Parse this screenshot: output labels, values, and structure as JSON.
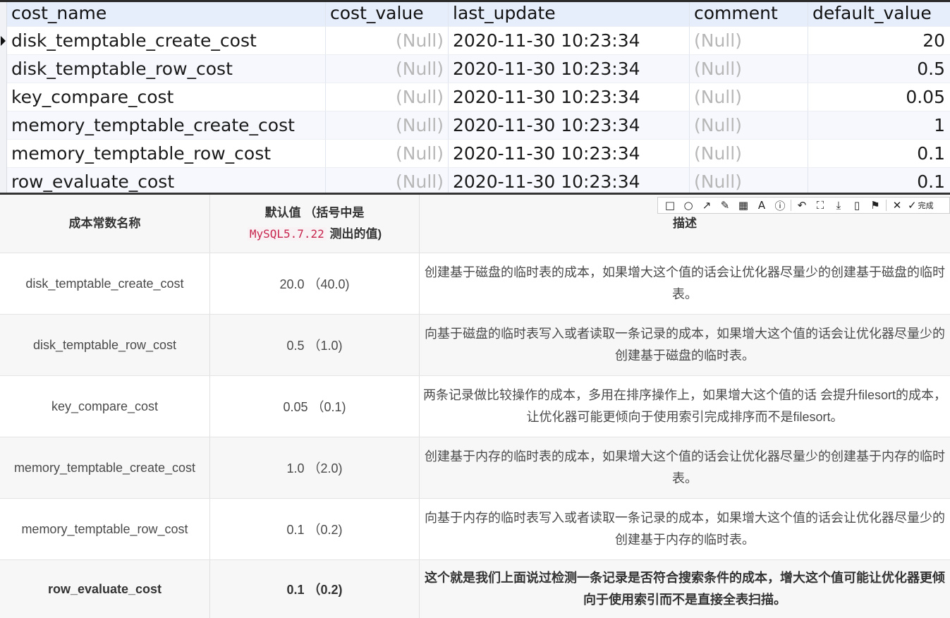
{
  "grid": {
    "columns": [
      "cost_name",
      "cost_value",
      "last_update",
      "comment",
      "default_value"
    ],
    "rows": [
      {
        "cost_name": "disk_temptable_create_cost",
        "cost_value": "(Null)",
        "last_update": "2020-11-30 10:23:34",
        "comment": "(Null)",
        "default_value": "20"
      },
      {
        "cost_name": "disk_temptable_row_cost",
        "cost_value": "(Null)",
        "last_update": "2020-11-30 10:23:34",
        "comment": "(Null)",
        "default_value": "0.5"
      },
      {
        "cost_name": "key_compare_cost",
        "cost_value": "(Null)",
        "last_update": "2020-11-30 10:23:34",
        "comment": "(Null)",
        "default_value": "0.05"
      },
      {
        "cost_name": "memory_temptable_create_cost",
        "cost_value": "(Null)",
        "last_update": "2020-11-30 10:23:34",
        "comment": "(Null)",
        "default_value": "1"
      },
      {
        "cost_name": "memory_temptable_row_cost",
        "cost_value": "(Null)",
        "last_update": "2020-11-30 10:23:34",
        "comment": "(Null)",
        "default_value": "0.1"
      },
      {
        "cost_name": "row_evaluate_cost",
        "cost_value": "(Null)",
        "last_update": "2020-11-30 10:23:34",
        "comment": "(Null)",
        "default_value": "0.1"
      }
    ]
  },
  "reference": {
    "headers": {
      "name": "成本常数名称",
      "default_line1": "默认值 （括号中是",
      "default_code": "MySQL5.7.22",
      "default_line2_suffix": " 测出的值)",
      "desc": "描述"
    },
    "rows": [
      {
        "name": "disk_temptable_create_cost",
        "default": "20.0 （40.0)",
        "desc": "创建基于磁盘的临时表的成本，如果增大这个值的话会让优化器尽量少的创建基于磁盘的临时表。"
      },
      {
        "name": "disk_temptable_row_cost",
        "default": "0.5 （1.0)",
        "desc": "向基于磁盘的临时表写入或者读取一条记录的成本，如果增大这个值的话会让优化器尽量少的创建基于磁盘的临时表。"
      },
      {
        "name": "key_compare_cost",
        "default": "0.05 （0.1)",
        "desc": "两条记录做比较操作的成本，多用在排序操作上，如果增大这个值的话 会提升filesort的成本，让优化器可能更倾向于使用索引完成排序而不是filesort。"
      },
      {
        "name": "memory_temptable_create_cost",
        "default": "1.0 （2.0)",
        "desc": "创建基于内存的临时表的成本，如果增大这个值的话会让优化器尽量少的创建基于内存的临时表。"
      },
      {
        "name": "memory_temptable_row_cost",
        "default": "0.1 （0.2)",
        "desc": "向基于内存的临时表写入或者读取一条记录的成本，如果增大这个值的话会让优化器尽量少的创建基于内存的临时表。"
      },
      {
        "name": "row_evaluate_cost",
        "default": "0.1 （0.2)",
        "desc": "这个就是我们上面说过检测一条记录是否符合搜索条件的成本，增大这个值可能让优化器更倾向于使用索引而不是直接全表扫描。"
      }
    ]
  },
  "toolbar": {
    "tools": [
      {
        "name": "rectangle-icon",
        "glyph": "□"
      },
      {
        "name": "ellipse-icon",
        "glyph": "○"
      },
      {
        "name": "arrow-icon",
        "glyph": "↗"
      },
      {
        "name": "pen-icon",
        "glyph": "✎"
      },
      {
        "name": "mosaic-icon",
        "glyph": "▦"
      },
      {
        "name": "text-icon",
        "glyph": "A"
      },
      {
        "name": "number-marker-icon",
        "glyph": "ⓘ"
      },
      {
        "name": "undo-icon",
        "glyph": "↶"
      },
      {
        "name": "ocr-icon",
        "glyph": "⛶"
      },
      {
        "name": "download-icon",
        "glyph": "⤓"
      },
      {
        "name": "pin-icon",
        "glyph": "▯"
      },
      {
        "name": "bookmark-icon",
        "glyph": "⚑"
      },
      {
        "name": "cancel-icon",
        "glyph": "✕"
      }
    ],
    "done_glyph": "✓",
    "done_label": "完成"
  }
}
